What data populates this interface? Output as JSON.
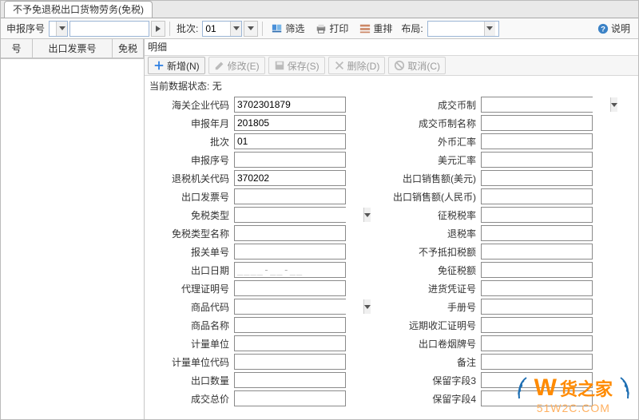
{
  "tab_title": "不予免退税出口货物劳务(免税)",
  "toolbar": {
    "seq_label": "申报序号",
    "seq_value": "",
    "batch_label": "批次:",
    "batch_value": "01",
    "filter": "筛选",
    "print": "打印",
    "rearrange": "重排",
    "layout_label": "布局:",
    "help": "说明"
  },
  "left_columns": {
    "col1": "号",
    "col2": "出口发票号",
    "col3": "免税"
  },
  "detail_title": "明细",
  "detail_toolbar": {
    "add": "新增(N)",
    "edit": "修改(E)",
    "save": "保存(S)",
    "delete": "删除(D)",
    "cancel": "取消(C)"
  },
  "status_prefix": "当前数据状态:",
  "status_value": "无",
  "left_fields": {
    "customs_code": {
      "label": "海关企业代码",
      "value": "3702301879"
    },
    "report_ym": {
      "label": "申报年月",
      "value": "201805"
    },
    "batch": {
      "label": "批次",
      "value": "01"
    },
    "report_seq": {
      "label": "申报序号",
      "value": ""
    },
    "tax_org": {
      "label": "退税机关代码",
      "value": "370202"
    },
    "export_inv": {
      "label": "出口发票号",
      "value": ""
    },
    "exempt_type": {
      "label": "免税类型",
      "value": ""
    },
    "exempt_name": {
      "label": "免税类型名称",
      "value": ""
    },
    "decl_no": {
      "label": "报关单号",
      "value": ""
    },
    "export_date": {
      "label": "出口日期",
      "value": "____-__-__"
    },
    "agent_cert": {
      "label": "代理证明号",
      "value": ""
    },
    "goods_code": {
      "label": "商品代码",
      "value": ""
    },
    "goods_name": {
      "label": "商品名称",
      "value": ""
    },
    "unit": {
      "label": "计量单位",
      "value": ""
    },
    "unit_code": {
      "label": "计量单位代码",
      "value": ""
    },
    "export_qty": {
      "label": "出口数量",
      "value": ""
    },
    "total_price": {
      "label": "成交总价",
      "value": ""
    }
  },
  "right_fields": {
    "currency": {
      "label": "成交币制",
      "value": ""
    },
    "currency_name": {
      "label": "成交币制名称",
      "value": ""
    },
    "fx_rate": {
      "label": "外币汇率",
      "value": ""
    },
    "usd_rate": {
      "label": "美元汇率",
      "value": ""
    },
    "sales_usd": {
      "label": "出口销售额(美元)",
      "value": ""
    },
    "sales_rmb": {
      "label": "出口销售额(人民币)",
      "value": ""
    },
    "levy_rate": {
      "label": "征税税率",
      "value": ""
    },
    "refund_rate": {
      "label": "退税率",
      "value": ""
    },
    "no_credit": {
      "label": "不予抵扣税额",
      "value": ""
    },
    "exempt_amt": {
      "label": "免征税额",
      "value": ""
    },
    "purchase_cert": {
      "label": "进货凭证号",
      "value": ""
    },
    "manual_no": {
      "label": "手册号",
      "value": ""
    },
    "fwd_fx_cert": {
      "label": "远期收汇证明号",
      "value": ""
    },
    "cig_brand": {
      "label": "出口卷烟牌号",
      "value": ""
    },
    "remark": {
      "label": "备注",
      "value": ""
    },
    "reserve3": {
      "label": "保留字段3",
      "value": ""
    },
    "reserve4": {
      "label": "保留字段4",
      "value": ""
    }
  },
  "watermark": {
    "main": "货之家",
    "sub": "51W2C.COM"
  }
}
